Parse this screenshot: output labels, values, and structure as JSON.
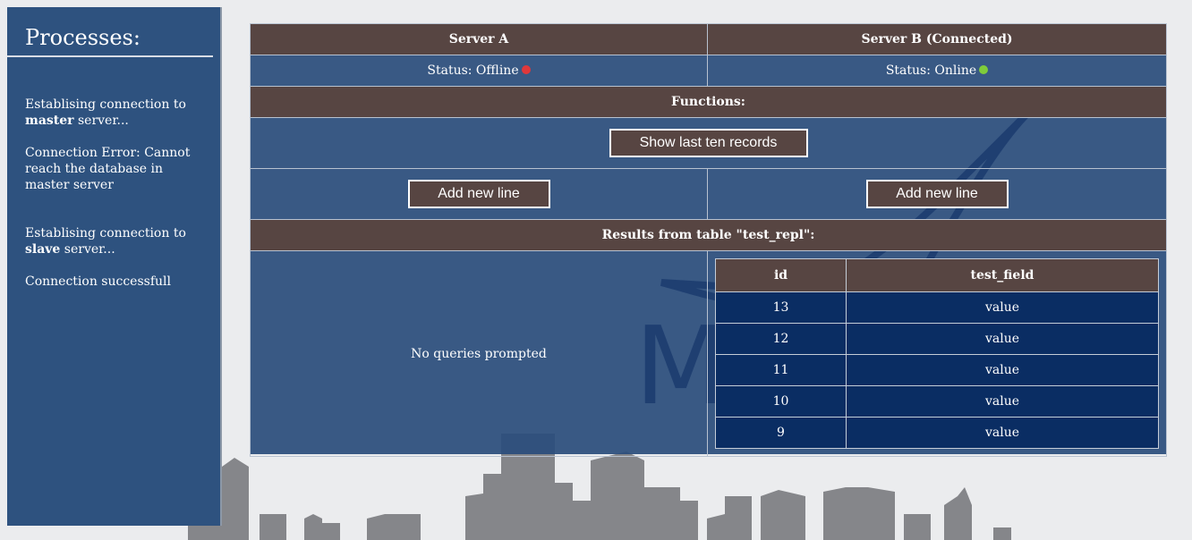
{
  "sidebar": {
    "title": "Processes:",
    "log": [
      {
        "pre": "Establising connection to ",
        "bold": "master",
        "post": " server..."
      },
      {
        "pre": "Connection Error: Cannot reach the database in master server",
        "bold": "",
        "post": ""
      },
      {
        "pre": "Establising connection to ",
        "bold": "slave",
        "post": " server..."
      },
      {
        "pre": "Connection successfull",
        "bold": "",
        "post": ""
      }
    ]
  },
  "servers": {
    "a": {
      "name": "Server A",
      "status": "Status: Offline",
      "status_color": "#e0383b"
    },
    "b": {
      "name": "Server B (Connected)",
      "status": "Status: Online",
      "status_color": "#7fcc3a"
    }
  },
  "functions": {
    "title": "Functions:",
    "show_last_label": "Show last ten records",
    "add_a_label": "Add new line",
    "add_b_label": "Add new line"
  },
  "results": {
    "title": "Results from table \"test_repl\":",
    "empty_text": "No queries prompted",
    "columns": [
      "id",
      "test_field"
    ],
    "rows": [
      [
        "13",
        "value"
      ],
      [
        "12",
        "value"
      ],
      [
        "11",
        "value"
      ],
      [
        "10",
        "value"
      ],
      [
        "9",
        "value"
      ]
    ]
  },
  "background": {
    "logo_text": "MariaDB"
  },
  "colors": {
    "accent_brown": "#574542",
    "panel_blue": "#2e527f",
    "table_navy": "#0a2d63"
  }
}
